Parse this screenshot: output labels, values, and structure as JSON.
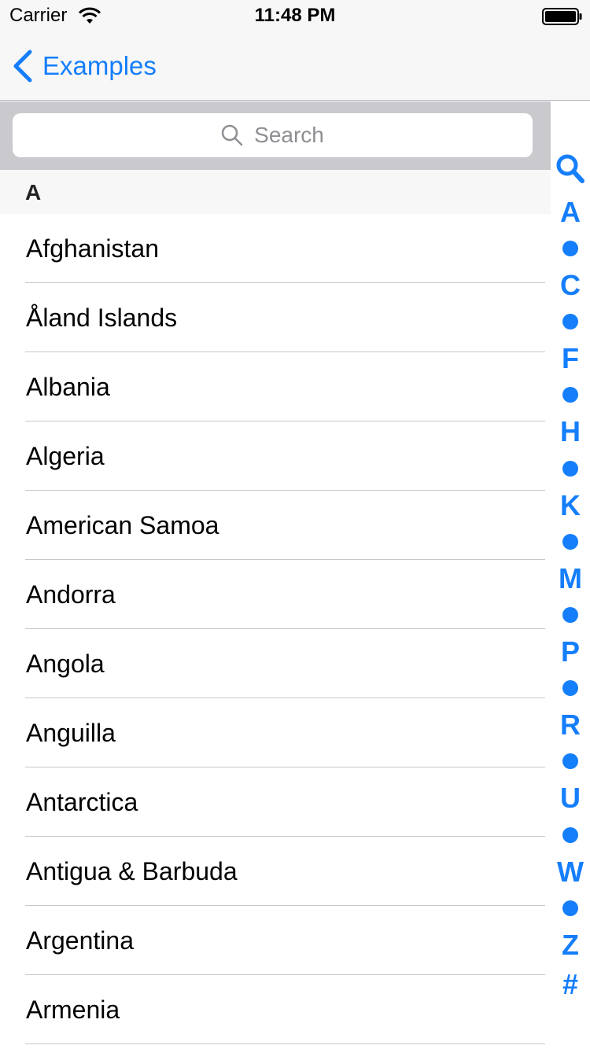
{
  "status_bar": {
    "carrier": "Carrier",
    "time": "11:48 PM"
  },
  "nav": {
    "back_label": "Examples",
    "accent_color": "#157efb"
  },
  "search": {
    "placeholder": "Search"
  },
  "section": {
    "header": "A"
  },
  "countries": [
    "Afghanistan",
    "Åland Islands",
    "Albania",
    "Algeria",
    "American Samoa",
    "Andorra",
    "Angola",
    "Anguilla",
    "Antarctica",
    "Antigua & Barbuda",
    "Argentina",
    "Armenia"
  ],
  "index": {
    "search_icon": "magnifying-glass-icon",
    "letters": [
      "A",
      "C",
      "F",
      "H",
      "K",
      "M",
      "P",
      "R",
      "U",
      "W",
      "Z",
      "#"
    ]
  }
}
